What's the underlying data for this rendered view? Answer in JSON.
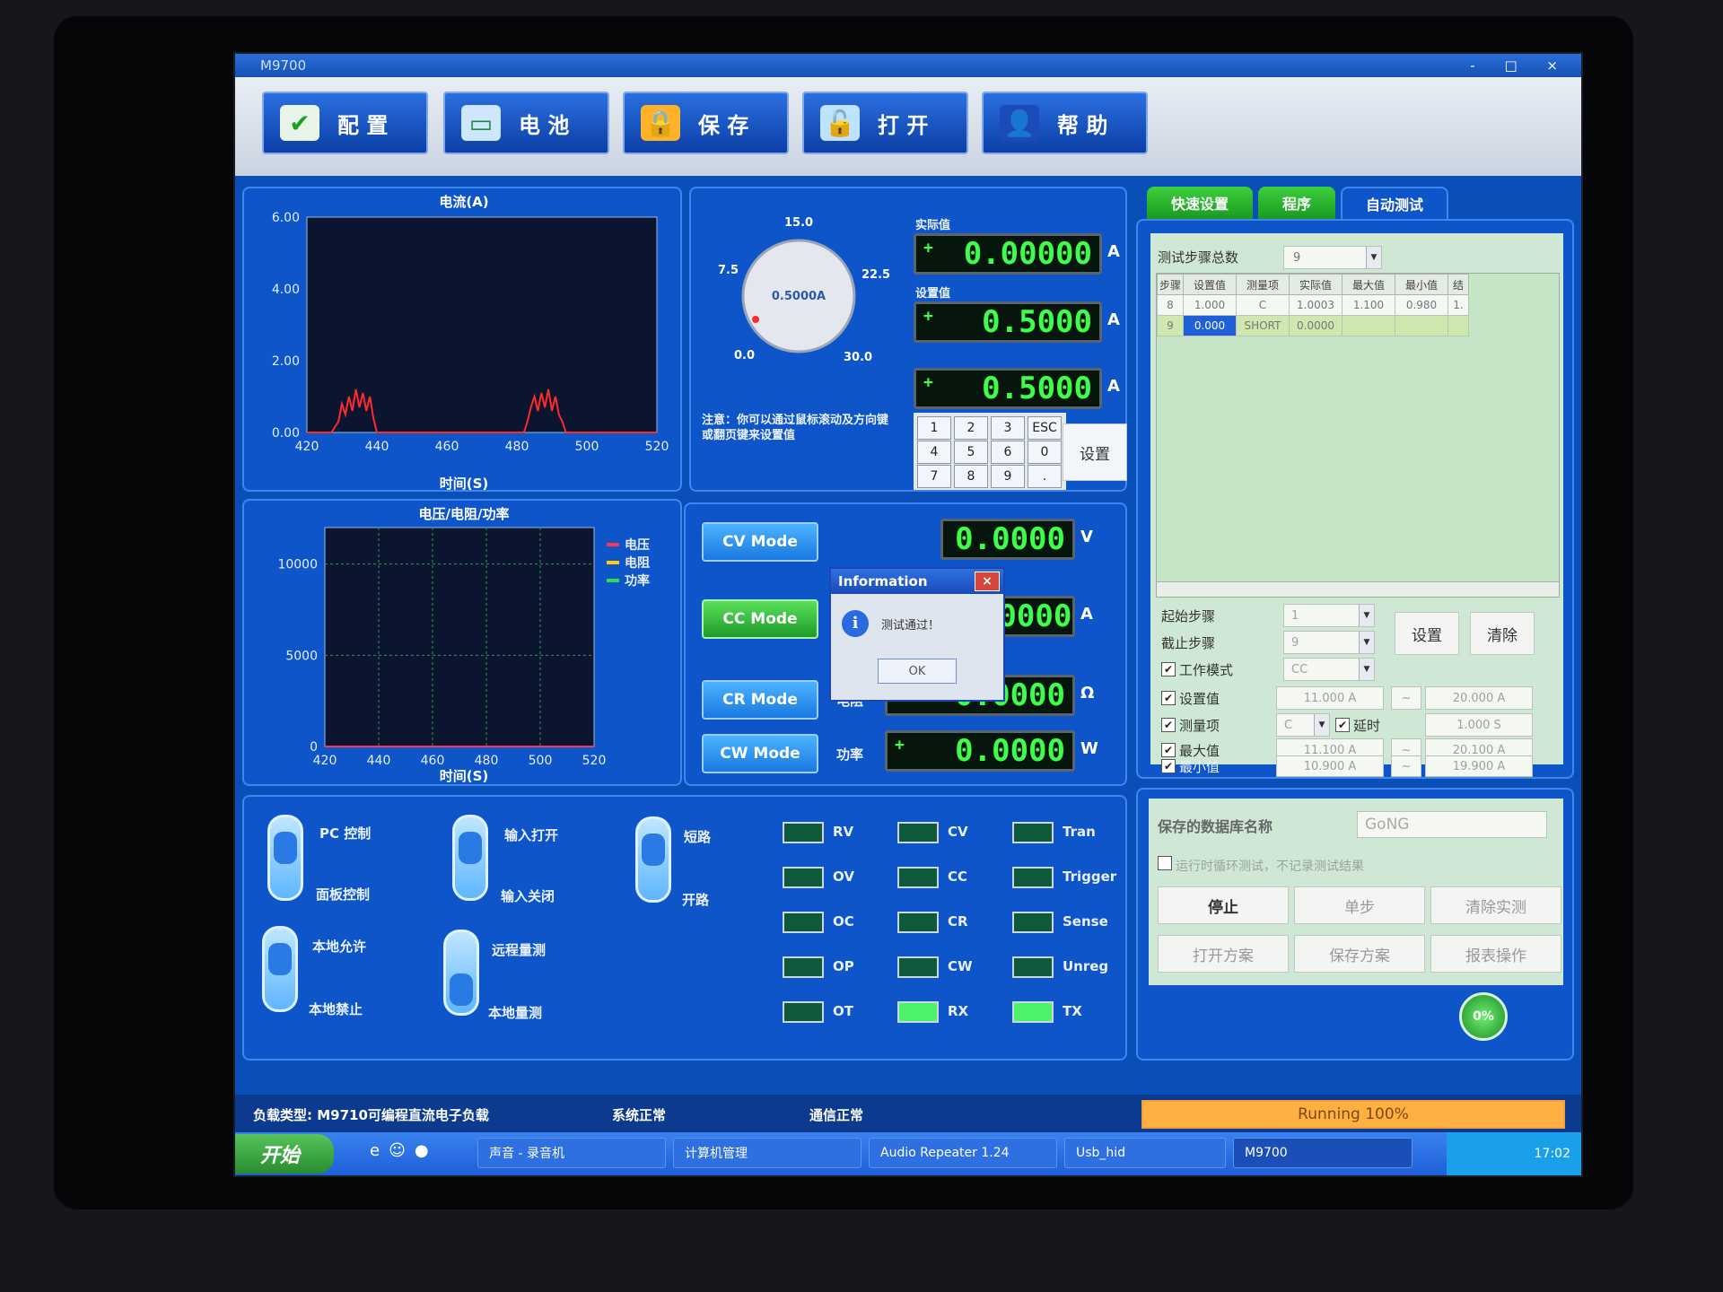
{
  "window": {
    "title": "M9700",
    "controls": "- □ ×"
  },
  "toolbar": {
    "config": "配 置",
    "battery": "电 池",
    "save": "保 存",
    "open": "打 开",
    "help": "帮 助"
  },
  "current_chart": {
    "title": "电流(A)",
    "xlabel": "时间(S)",
    "yticks": [
      "6.00",
      "4.00",
      "2.00",
      "0.00"
    ],
    "xticks": [
      "420",
      "440",
      "460",
      "480",
      "500",
      "520"
    ]
  },
  "vrp_chart": {
    "title": "电压/电阻/功率",
    "xlabel": "时间(S)",
    "yticks": [
      "10000",
      "5000",
      "0"
    ],
    "xticks": [
      "420",
      "440",
      "460",
      "480",
      "500",
      "520"
    ],
    "legend": [
      "电压",
      "电阻",
      "功率"
    ]
  },
  "chart_data": [
    {
      "type": "line",
      "title": "电流(A)",
      "xlabel": "时间(S)",
      "ylabel": "",
      "xlim": [
        420,
        520
      ],
      "ylim": [
        0,
        6
      ],
      "series": [
        {
          "color": "#ff2a2a",
          "x": [
            420,
            427,
            429,
            430,
            431,
            432,
            433,
            434,
            435,
            436,
            437,
            438,
            439,
            440,
            441,
            482,
            483,
            484,
            485,
            486,
            487,
            488,
            489,
            490,
            491,
            492,
            493,
            494,
            520
          ],
          "y": [
            0.0,
            0.0,
            0.3,
            0.8,
            0.5,
            1.0,
            0.6,
            1.2,
            0.7,
            1.1,
            0.6,
            1.0,
            0.4,
            0.0,
            0.0,
            0.0,
            0.3,
            0.7,
            1.0,
            0.6,
            1.1,
            0.7,
            1.2,
            0.6,
            1.0,
            0.5,
            0.3,
            0.0,
            0.0
          ]
        }
      ]
    },
    {
      "type": "line",
      "title": "电压/电阻/功率",
      "xlabel": "时间(S)",
      "ylabel": "",
      "xlim": [
        420,
        520
      ],
      "ylim": [
        0,
        12000
      ],
      "series": [
        {
          "name": "电压",
          "color": "#ff3355",
          "x": [
            420,
            520
          ],
          "y": [
            0,
            0
          ]
        },
        {
          "name": "电阻",
          "color": "#ffd000",
          "x": [],
          "y": []
        },
        {
          "name": "功率",
          "color": "#33dd44",
          "x": [],
          "y": []
        }
      ]
    }
  ],
  "dial": {
    "value": "0.5000A",
    "ticks": [
      "0.0",
      "7.5",
      "15.0",
      "22.5",
      "30.0"
    ],
    "note": "注意：你可以通过鼠标滚动及方向键或翻页键来设置值"
  },
  "readouts": {
    "actual_label": "实际值",
    "actual": "0.00000",
    "set_label": "设置值",
    "set": "0.5000",
    "input": "0.5000",
    "unit_a": "A"
  },
  "keypad": {
    "keys": [
      "1",
      "2",
      "3",
      "ESC",
      "4",
      "5",
      "6",
      "0",
      "7",
      "8",
      "9",
      "."
    ],
    "set_button": "设置"
  },
  "modes": {
    "cv": {
      "label": "CV Mode",
      "value": "0.0000",
      "unit": "V"
    },
    "cc": {
      "label": "CC Mode",
      "value": "0.00000",
      "unit": "A"
    },
    "cr": {
      "label": "CR Mode",
      "field": "电阻",
      "value": "0.0000",
      "unit": "Ω"
    },
    "cw": {
      "label": "CW Mode",
      "field": "功率",
      "value": "0.0000",
      "unit": "W"
    }
  },
  "dialog": {
    "title": "Information",
    "message": "测试通过！",
    "ok": "OK",
    "close": "×"
  },
  "switches": {
    "pc_control": "PC 控制",
    "panel_control": "面板控制",
    "input_on": "输入打开",
    "input_off": "输入关闭",
    "short": "短路",
    "open": "开路",
    "local_allow": "本地允许",
    "local_forbid": "本地禁止",
    "remote_measure": "远程量测",
    "local_measure": "本地量测"
  },
  "leds": [
    {
      "label": "RV",
      "on": false
    },
    {
      "label": "CV",
      "on": false
    },
    {
      "label": "Tran",
      "on": false
    },
    {
      "label": "OV",
      "on": false
    },
    {
      "label": "CC",
      "on": false
    },
    {
      "label": "Trigger",
      "on": false
    },
    {
      "label": "OC",
      "on": false
    },
    {
      "label": "CR",
      "on": false
    },
    {
      "label": "Sense",
      "on": false
    },
    {
      "label": "OP",
      "on": false
    },
    {
      "label": "CW",
      "on": false
    },
    {
      "label": "Unreg",
      "on": false
    },
    {
      "label": "OT",
      "on": false
    },
    {
      "label": "RX",
      "on": true
    },
    {
      "label": "TX",
      "on": true
    }
  ],
  "tabs": [
    "快速设置",
    "程序",
    "自动测试"
  ],
  "auto_test": {
    "total_steps_label": "测试步骤总数",
    "total_steps": "9",
    "columns": [
      "步骤",
      "设置值",
      "测量项",
      "实际值",
      "最大值",
      "最小值",
      "结"
    ],
    "rows": [
      [
        "8",
        "1.000",
        "C",
        "1.0003",
        "1.100",
        "0.980",
        "1."
      ],
      [
        "9",
        "0.000",
        "SHORT",
        "0.0000",
        "",
        "",
        ""
      ]
    ],
    "start_step_label": "起始步骤",
    "start_step": "1",
    "end_step_label": "截止步骤",
    "end_step": "9",
    "work_mode_label": "工作模式",
    "work_mode": "CC",
    "set_value_label": "设置值",
    "set_value_from": "11.000 A",
    "set_value_to": "20.000 A",
    "measure_label": "测量项",
    "measure": "C",
    "delay_label": "延时",
    "delay": "1.000 S",
    "max_label": "最大值",
    "max_from": "11.100 A",
    "max_to": "20.100 A",
    "min_label": "最小值",
    "min_from": "10.900 A",
    "min_to": "19.900 A",
    "tilde": "~",
    "set_button": "设置",
    "clear_button": "清除"
  },
  "db": {
    "name_label": "保存的数据库名称",
    "name": "GoNG",
    "loop_label": "运行时循环测试，不记录测试结果",
    "stop": "停止",
    "single_step": "单步",
    "clear_report": "清除实测",
    "open_scheme": "打开方案",
    "save_scheme": "保存方案",
    "report": "报表操作",
    "progress_pct": "0%",
    "progress_text": "Running 100%",
    "progress": 1.0
  },
  "status": {
    "load_type": "负载类型: M9710可编程直流电子负载",
    "system": "系统正常",
    "comm": "通信正常"
  },
  "taskbar": {
    "start": "开始",
    "tasks": [
      "声音 - 录音机",
      "计算机管理",
      "Audio Repeater 1.24",
      "Usb_hid",
      "M9700"
    ],
    "clock": "17:02"
  }
}
